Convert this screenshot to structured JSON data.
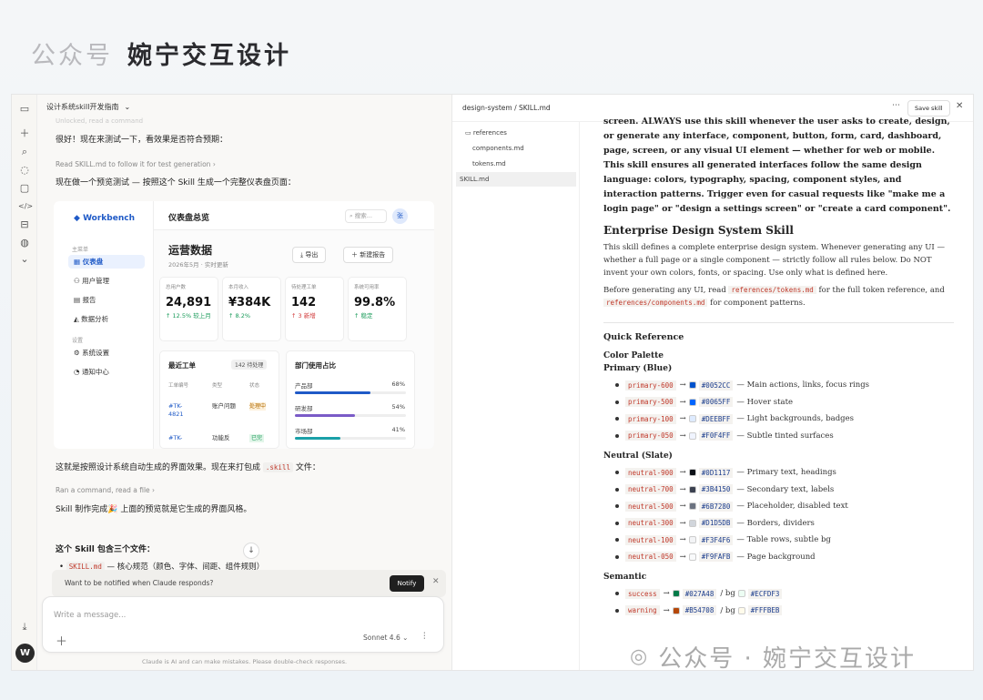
{
  "brand": {
    "account": "公众号",
    "name": "婉宁交互设计"
  },
  "rail": {
    "icons": [
      "sidebar-icon",
      "new-chat-icon",
      "search-icon",
      "chats-icon",
      "projects-icon",
      "code-icon",
      "artifacts-icon",
      "palette-icon",
      "more-icon"
    ],
    "avatar_letter": "W"
  },
  "chat": {
    "title": "设计系统skill开发指南",
    "faint_line": "Unlocked, read a command",
    "msg1": "很好！现在来测试一下，看效果是否符合预期：",
    "meta1": "Read SKILL.md to follow it for test generation",
    "msg2": "现在做一个预览测试 — 按照这个 Skill 生成一个完整仪表盘页面：",
    "msg3a": "这就是按照设计系统自动生成的界面效果。现在来打包成",
    "msg3code": ".skill",
    "msg3b": "文件：",
    "meta2": "Ran a command, read a file",
    "msg4": "Skill 制作完成🎉 上面的预览就是它生成的界面风格。",
    "msg5": "这个 Skill 包含三个文件：",
    "list1code": "SKILL.md",
    "list1text": "— 核心规范（颜色、字体、间距、组件规则）",
    "notify_text": "Want to be notified when Claude responds?",
    "notify_btn": "Notify",
    "placeholder": "Write a message...",
    "model": "Sonnet 4.6",
    "disclaimer": "Claude is AI and can make mistakes. Please double-check responses."
  },
  "preview": {
    "logo": "Workbench",
    "sec_main": "主菜单",
    "nav": [
      "仪表盘",
      "用户管理",
      "报告",
      "数据分析"
    ],
    "sec_settings": "设置",
    "nav2": [
      "系统设置",
      "通知中心"
    ],
    "header_title": "仪表盘总览",
    "search": "搜索...",
    "avatar": "张",
    "h1": "运营数据",
    "sub": "2026年5月 · 实时更新",
    "btn_export": "导出",
    "btn_new": "新建报告",
    "kpis": [
      {
        "label": "总用户数",
        "value": "24,891",
        "delta": "↑ 12.5% 较上月",
        "color": "#1a9b5a"
      },
      {
        "label": "本月收入",
        "value": "¥384K",
        "delta": "↑ 8.2%",
        "color": "#1a9b5a"
      },
      {
        "label": "待处理工单",
        "value": "142",
        "delta": "↑ 3 新增",
        "color": "#d23b3b"
      },
      {
        "label": "系统可用率",
        "value": "99.8%",
        "delta": "↑ 稳定",
        "color": "#1a9b5a"
      }
    ],
    "tickets_title": "最近工单",
    "tickets_badge": "142 待处理",
    "ticket_cols": [
      "工单编号",
      "类型",
      "状态"
    ],
    "ticket_rows": [
      {
        "id": "#TK-4821",
        "type": "账户问题",
        "status": "处理中"
      },
      {
        "id": "#TK-",
        "type": "功能反",
        "status": "已完"
      }
    ],
    "dept_title": "部门使用占比",
    "depts": [
      {
        "name": "产品部",
        "pct": "68%",
        "value": 68,
        "color": "#1f5ac7"
      },
      {
        "name": "研发部",
        "pct": "54%",
        "value": 54,
        "color": "#7a5bc7"
      },
      {
        "name": "市场部",
        "pct": "41%",
        "value": 41,
        "color": "#1aa0a8"
      }
    ]
  },
  "doc": {
    "path": "design-system / SKILL.md",
    "save": "Save skill",
    "tree": [
      "references",
      "components.md",
      "tokens.md",
      "SKILL.md"
    ],
    "intro": "screen. ALWAYS use this skill whenever the user asks to create, design, or generate any interface, component, button, form, card, dashboard, page, screen, or any visual UI element — whether for web or mobile. This skill ensures all generated interfaces follow the same design language: colors, typography, spacing, component styles, and interaction patterns. Trigger even for casual requests like \"make me a login page\" or \"design a settings screen\" or \"create a card component\".",
    "h2": "Enterprise Design System Skill",
    "p1": "This skill defines a complete enterprise design system. Whenever generating any UI — whether a full page or a single component — strictly follow all rules below. Do NOT invent your own colors, fonts, or spacing. Use only what is defined here.",
    "p2a": "Before generating any UI, read",
    "p2code1": "references/tokens.md",
    "p2b": "for the full token reference, and",
    "p2code2": "references/components.md",
    "p2c": "for component patterns.",
    "h3": "Quick Reference",
    "palette_title": "Color Palette",
    "primary_title": "Primary (Blue)",
    "primary": [
      {
        "tok": "primary-600",
        "hex": "#0052CC",
        "desc": "— Main actions, links, focus rings"
      },
      {
        "tok": "primary-500",
        "hex": "#0065FF",
        "desc": "— Hover state"
      },
      {
        "tok": "primary-100",
        "hex": "#DEEBFF",
        "desc": "— Light backgrounds, badges"
      },
      {
        "tok": "primary-050",
        "hex": "#F0F4FF",
        "desc": "— Subtle tinted surfaces"
      }
    ],
    "neutral_title": "Neutral (Slate)",
    "neutral": [
      {
        "tok": "neutral-900",
        "hex": "#0D1117",
        "desc": "— Primary text, headings"
      },
      {
        "tok": "neutral-700",
        "hex": "#3B4150",
        "desc": "— Secondary text, labels"
      },
      {
        "tok": "neutral-500",
        "hex": "#6B7280",
        "desc": "— Placeholder, disabled text"
      },
      {
        "tok": "neutral-300",
        "hex": "#D1D5DB",
        "desc": "— Borders, dividers"
      },
      {
        "tok": "neutral-100",
        "hex": "#F3F4F6",
        "desc": "— Table rows, subtle bg"
      },
      {
        "tok": "neutral-050",
        "hex": "#F9FAFB",
        "desc": "— Page background"
      }
    ],
    "semantic_title": "Semantic",
    "semantic": [
      {
        "tok": "success",
        "hex": "#027A48",
        "desc": "/ bg",
        "hex2": "#ECFDF3"
      },
      {
        "tok": "warning",
        "hex": "#B54708",
        "desc": "/ bg",
        "hex2": "#FFFBEB"
      }
    ]
  },
  "watermark": "公众号 · 婉宁交互设计"
}
